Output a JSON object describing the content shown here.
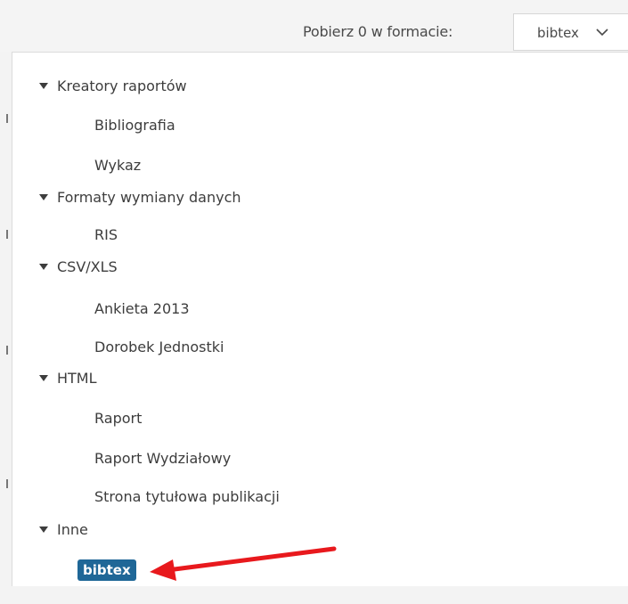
{
  "header": {
    "download_label": "Pobierz 0 w formacie:",
    "selected_format": "bibtex"
  },
  "dropdown": {
    "groups": [
      {
        "label": "Kreatory raportów",
        "items": [
          "Bibliografia",
          "Wykaz"
        ]
      },
      {
        "label": "Formaty wymiany danych",
        "items": [
          "RIS"
        ]
      },
      {
        "label": "CSV/XLS",
        "items": [
          "Ankieta 2013",
          "Dorobek Jednostki"
        ]
      },
      {
        "label": "HTML",
        "items": [
          "Raport",
          "Raport Wydziałowy",
          "Strona tytułowa publikacji"
        ]
      },
      {
        "label": "Inne",
        "items": [
          "bibtex"
        ]
      }
    ],
    "selected_item": "bibtex"
  },
  "colors": {
    "selected_background": "#1f6797",
    "annotation_arrow": "#e8191d"
  },
  "icons": {
    "group_toggle": "triangle-down-icon",
    "select_chevron": "chevron-down-icon",
    "annotation": "red-arrow-icon"
  }
}
